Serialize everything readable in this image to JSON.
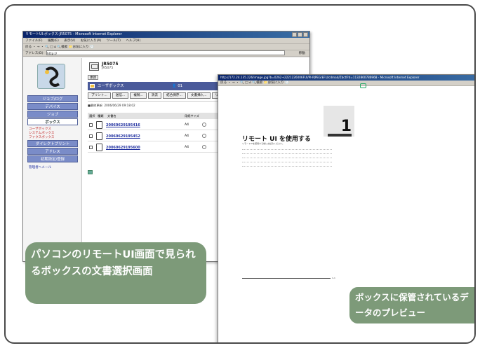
{
  "window1": {
    "title": "リモートUI:ボックス-JR5075 - Microsoft Internet Explorer",
    "menu": [
      "ファイル(F)",
      "編集(E)",
      "表示(V)",
      "お気に入り(A)",
      "ツール(T)",
      "ヘルプ(H)"
    ],
    "toolbar": "戻る ・ → ・ 🔍 □ ⌂  🔍検索  📁お気に入り  🕑",
    "address_label": "アドレス(D)",
    "address_value": "http://",
    "go_label": "移動"
  },
  "sidebar": {
    "nav": [
      {
        "label": "デバイス"
      },
      {
        "label": "ジョブ"
      },
      {
        "label": "ボックス"
      }
    ],
    "top_label": "ジョブ/ログ",
    "subitems": [
      "ユーザボックス",
      "システムボックス",
      "ファクスボックス"
    ],
    "nav2": [
      {
        "label": "ダイレクトプリント"
      },
      {
        "label": "アドレス"
      },
      {
        "label": "初期設定/登録"
      }
    ],
    "link": "管理者へメール"
  },
  "main": {
    "device_name": "JR5075",
    "device_sub": "JR5075",
    "update_button": "更新",
    "box_header": "ユーザボックス",
    "box_number": "01",
    "buttons": [
      "プリント...",
      "送信...",
      "複製...",
      "消去",
      "結合保存...",
      "文書挿入...",
      "リストプリント"
    ],
    "update_time": "■最終更新: 2006/06/29 09:18:02",
    "table_headers": {
      "select": "選択",
      "type": "種類",
      "name": "文書名",
      "size": "用紙サイズ",
      "pages": "ページ"
    },
    "rows": [
      {
        "name": "20060629195416",
        "size": "A4",
        "pages": "1"
      },
      {
        "name": "20060629195452",
        "size": "A4",
        "pages": "1"
      },
      {
        "name": "20060629195600",
        "size": "A4",
        "pages": "1"
      }
    ]
  },
  "window2": {
    "title": "http://172.24.135.226/image.jpg?b=0262+2221226006FUI/PI-PJPEG/EFU/cdmad/Zbctl?d=1132860786968 - Microsoft Internet Explorer",
    "menu": "戻る ・ → ・ 🔍 □ ⌂  🔍検索  📁お気に入り  🕑"
  },
  "preview": {
    "chapter_number": "1",
    "title": "リモート UI を使用する",
    "subtitle": "リモートUIを使用する前にお読みください。",
    "page_number": "1-1"
  },
  "captions": {
    "left": "パソコンのリモートUI画面で見られるボックスの文書選択画面",
    "right": "ボックスに保管されているデータのプレビュー"
  },
  "colors": {
    "caption_bg": "#7d9a79",
    "nav_bg": "#7a8cc8",
    "header_bg": "#4a5a9a",
    "titlebar": "#0a246a"
  }
}
